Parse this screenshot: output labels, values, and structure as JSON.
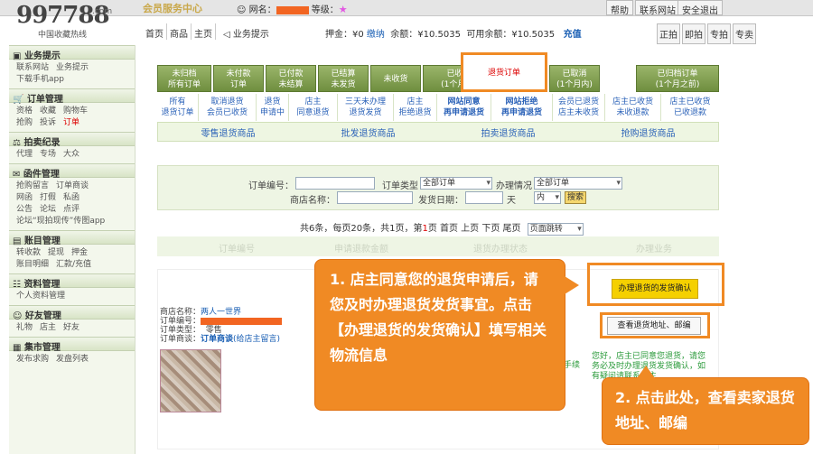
{
  "topbar": {
    "service": "会员服务中心",
    "user_label": "网名：",
    "level_label": "等级：",
    "star": "★",
    "links": [
      "帮助",
      "联系网站",
      "安全退出"
    ]
  },
  "logo": {
    "text": "997788",
    "com": ".com",
    "cn": "中国收藏热线"
  },
  "nav": {
    "items": [
      "首页",
      "商品",
      "主页"
    ],
    "tip": "业务提示",
    "deposit_label": "押金：",
    "deposit_value": "¥0",
    "pay": "缴纳",
    "balance_label": "余额：",
    "balance_value": "¥10.5035",
    "avail_label": "可用余额：",
    "avail_value": "¥10.5035",
    "recharge": "充值",
    "right": [
      "正拍",
      "即拍",
      "专拍",
      "专卖"
    ]
  },
  "sidebar": [
    {
      "title": "业务提示",
      "links": [
        "联系网站",
        "业务提示",
        "下载手机app"
      ]
    },
    {
      "title": "订单管理",
      "links": [
        "资格",
        "收藏",
        "购物车",
        "抢购",
        "投诉",
        "订单"
      ]
    },
    {
      "title": "拍卖纪录",
      "links": [
        "代理",
        "专场",
        "大众"
      ]
    },
    {
      "title": "函件管理",
      "links": [
        "抢购留言",
        "订单商谈",
        "网函",
        "打假",
        "私函",
        "公告",
        "论坛",
        "点评",
        "论坛“现拍现传”传图app"
      ]
    },
    {
      "title": "账目管理",
      "links": [
        "转收款",
        "提现",
        "押金",
        "账目明细",
        "汇款/充值"
      ]
    },
    {
      "title": "资料管理",
      "links": [
        "个人资料管理"
      ]
    },
    {
      "title": "好友管理",
      "links": [
        "礼物",
        "店主",
        "好友"
      ]
    },
    {
      "title": "集市管理",
      "links": [
        "发布求购",
        "发盘列表"
      ]
    }
  ],
  "tabs1": [
    [
      "未归档",
      "所有订单"
    ],
    [
      "未付款",
      "订单"
    ],
    [
      "已付款",
      "未结算"
    ],
    [
      "已结算",
      "未发货"
    ],
    [
      "未收货",
      ""
    ],
    [
      "已收货",
      "(1个月内)"
    ],
    [
      "退货订单",
      ""
    ],
    [
      "已取消",
      "(1个月内)"
    ],
    [
      "已归档订单",
      "(1个月之前)"
    ]
  ],
  "tabs2": [
    [
      "所有",
      "退货订单"
    ],
    [
      "取消退货",
      "会员已收货"
    ],
    [
      "退货",
      "申请中"
    ],
    [
      "店主",
      "同意退货"
    ],
    [
      "三天未办理",
      "退货发货"
    ],
    [
      "店主",
      "拒绝退货"
    ],
    [
      "网站同意",
      "再申请退货"
    ],
    [
      "网站拒绝",
      "再申请退货"
    ],
    [
      "会员已退货",
      "店主未收货"
    ],
    [
      "店主已收货",
      "未收退款"
    ],
    [
      "店主已收货",
      "已收退款"
    ]
  ],
  "tabs3": [
    "零售退货商品",
    "批发退货商品",
    "拍卖退货商品",
    "抢购退货商品"
  ],
  "search": {
    "order_no": "订单编号：",
    "order_type": "订单类型",
    "order_type_val": "全部订单",
    "handle": "办理情况",
    "handle_val": "全部订单",
    "shop": "商店名称：",
    "ship_date": "发货日期：",
    "day": "天",
    "within": "内",
    "btn": "搜索"
  },
  "pager": {
    "pre": "共6条，每页20条，共1页，第",
    "page": "1",
    "post": "页 首页 上页 下页 尾页",
    "jump": "页面跳转"
  },
  "thead": [
    "订单编号",
    "申请退款金额",
    "退货办理状态",
    "办理业务"
  ],
  "order": {
    "shop_label": "商店名称：",
    "shop": "两人一世界",
    "no_label": "订单编号：",
    "type_label": "订单类型：",
    "type": "零售",
    "chat_label": "订单商谈：",
    "chat": "订单商谈",
    "chat_note": "(给店主留言)"
  },
  "actions": {
    "confirm": "办理退货的发货确认",
    "address": "查看退货地址、邮编",
    "msg": "您好，店主已同意您退货，请您务必及时办理退货发货确认，如有疑问请联系店主",
    "shipping": "手续"
  },
  "callouts": {
    "c1": "1. 店主同意您的退货申请后，请您及时办理退货发货事宜。点击【办理退货的发货确认】填写相关物流信息",
    "c2": "2. 点击此处，查看卖家退货地址、邮编"
  }
}
